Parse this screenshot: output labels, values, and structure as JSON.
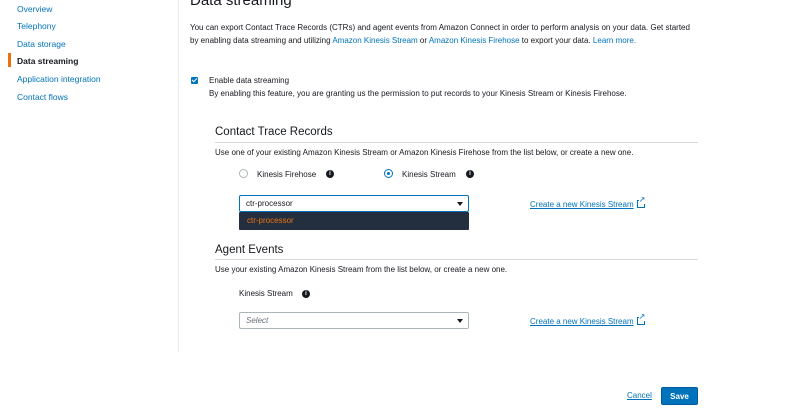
{
  "sidebar": {
    "items": [
      {
        "label": "Overview",
        "active": false
      },
      {
        "label": "Telephony",
        "active": false
      },
      {
        "label": "Data storage",
        "active": false
      },
      {
        "label": "Data streaming",
        "active": true
      },
      {
        "label": "Application integration",
        "active": false
      },
      {
        "label": "Contact flows",
        "active": false
      }
    ]
  },
  "page": {
    "title": "Data streaming",
    "intro_part1": "You can export Contact Trace Records (CTRs) and agent events from Amazon Connect in order to perform analysis on your data. Get started by enabling data streaming and utilizing ",
    "intro_link1": "Amazon Kinesis Stream",
    "intro_or": " or ",
    "intro_link2": "Amazon Kinesis Firehose",
    "intro_part2": " to export your data. ",
    "intro_learn_more": "Learn more."
  },
  "enable": {
    "checked": true,
    "label": "Enable data streaming",
    "description": "By enabling this feature, you are granting us the permission to put records to your Kinesis Stream or Kinesis Firehose."
  },
  "ctr": {
    "heading": "Contact Trace Records",
    "description": "Use one of your existing Amazon Kinesis Stream or Amazon Kinesis Firehose from the list below, or create a new one.",
    "radio_firehose": "Kinesis Firehose",
    "radio_stream": "Kinesis Stream",
    "selected_radio": "Kinesis Stream",
    "select_value": "ctr-processor",
    "dropdown_option": "ctr-processor",
    "create_link": "Create a new Kinesis Stream"
  },
  "agent": {
    "heading": "Agent Events",
    "description": "Use your existing Amazon Kinesis Stream from the list below, or create a new one.",
    "field_label": "Kinesis Stream",
    "select_placeholder": "Select",
    "create_link": "Create a new Kinesis Stream"
  },
  "footer": {
    "cancel_label": "Cancel",
    "save_label": "Save"
  },
  "colors": {
    "link": "#0073bb",
    "accent_orange": "#ec7211",
    "dropdown_bg": "#232f3e",
    "primary_button": "#0073bb"
  },
  "icons": [
    "info-icon",
    "external-link-icon",
    "chevron-down-icon",
    "checkbox-checked-icon"
  ]
}
